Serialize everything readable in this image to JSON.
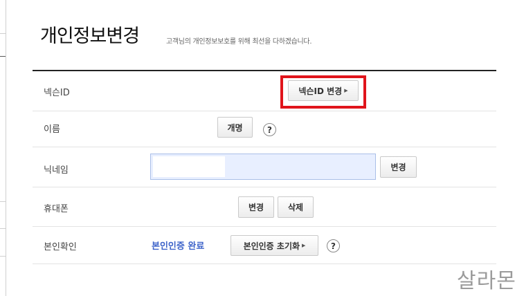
{
  "page": {
    "title": "개인정보변경",
    "subtitle": "고객님의 개인정보보호를 위해 최선을 다하겠습니다."
  },
  "rows": {
    "nexon_id": {
      "label": "넥슨ID",
      "button": "넥슨ID 변경"
    },
    "name": {
      "label": "이름",
      "button": "개명",
      "help": "?"
    },
    "nickname": {
      "label": "닉네임",
      "button": "변경"
    },
    "phone": {
      "label": "휴대폰",
      "change_button": "변경",
      "delete_button": "삭제"
    },
    "verification": {
      "label": "본인확인",
      "status": "본인인증 완료",
      "button": "본인인증 초기화",
      "help": "?"
    }
  },
  "watermark": "살라몬",
  "colors": {
    "highlight": "#e0141b",
    "verified": "#3d63c9",
    "field_bg": "#e8efff"
  }
}
